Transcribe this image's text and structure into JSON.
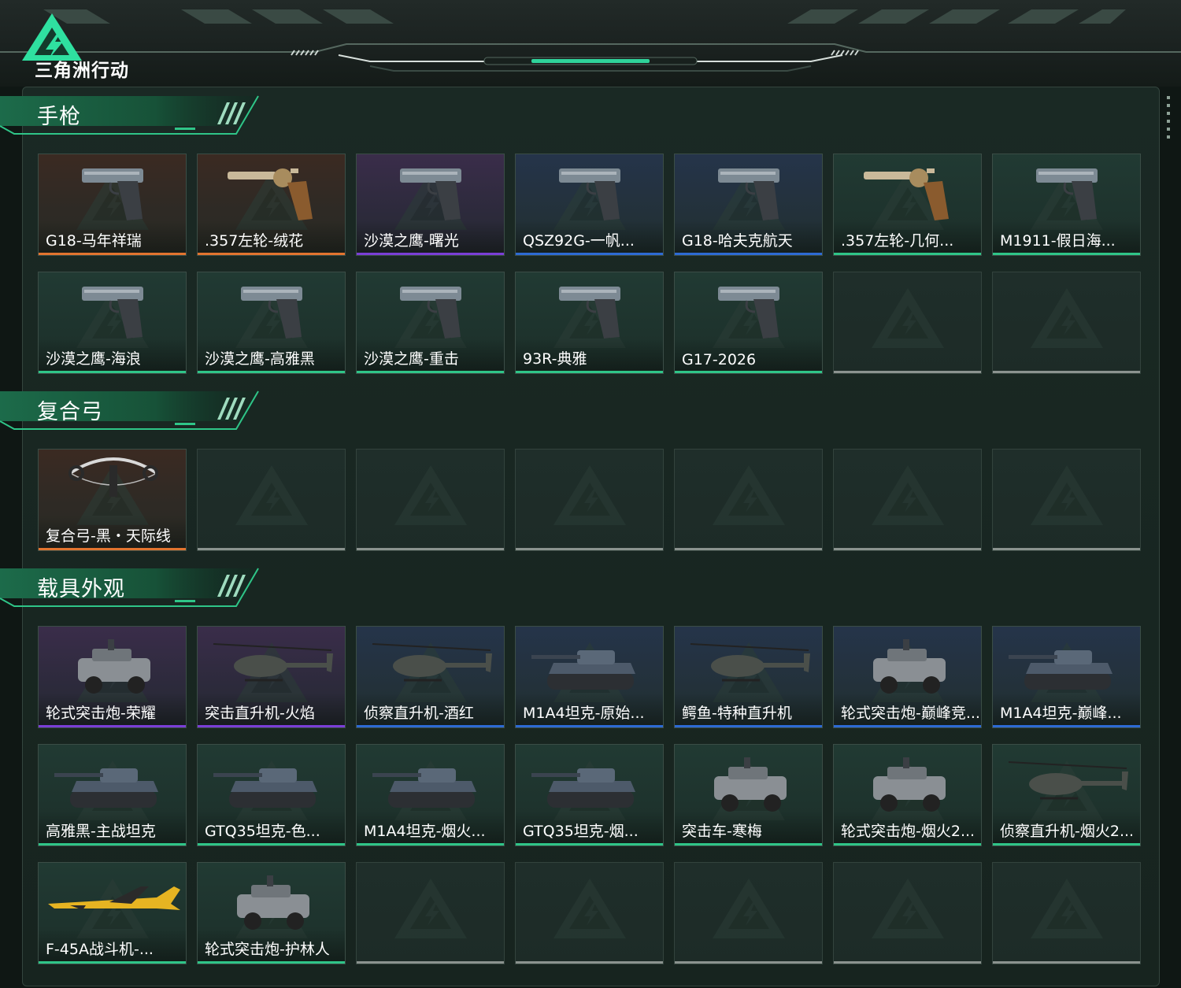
{
  "game": {
    "logo_text": "三角洲行动"
  },
  "colors": {
    "rarity_orange": "#e2742f",
    "rarity_purple": "#7a3ed6",
    "rarity_blue": "#2d6ad3",
    "rarity_green": "#2fc588",
    "accent": "#3fe0a0"
  },
  "sections": [
    {
      "title": "手枪",
      "items": [
        {
          "name": "G18-马年祥瑞",
          "rarity": "orange",
          "icon": "pistol-icon"
        },
        {
          "name": ".357左轮-绒花",
          "rarity": "orange",
          "icon": "revolver-icon"
        },
        {
          "name": "沙漠之鹰-曙光",
          "rarity": "purple",
          "icon": "pistol-icon"
        },
        {
          "name": "QSZ92G-一帆...",
          "rarity": "blue",
          "icon": "pistol-icon"
        },
        {
          "name": "G18-哈夫克航天",
          "rarity": "blue",
          "icon": "pistol-icon"
        },
        {
          "name": ".357左轮-几何...",
          "rarity": "green",
          "icon": "revolver-icon"
        },
        {
          "name": "M1911-假日海...",
          "rarity": "green",
          "icon": "pistol-icon"
        },
        {
          "name": "沙漠之鹰-海浪",
          "rarity": "green",
          "icon": "pistol-icon"
        },
        {
          "name": "沙漠之鹰-高雅黑",
          "rarity": "green",
          "icon": "pistol-icon"
        },
        {
          "name": "沙漠之鹰-重击",
          "rarity": "green",
          "icon": "pistol-icon"
        },
        {
          "name": "93R-典雅",
          "rarity": "green",
          "icon": "pistol-icon"
        },
        {
          "name": "G17-2026",
          "rarity": "green",
          "icon": "pistol-icon"
        },
        {
          "name": "",
          "rarity": "empty"
        },
        {
          "name": "",
          "rarity": "empty"
        }
      ]
    },
    {
      "title": "复合弓",
      "items": [
        {
          "name": "复合弓-黑・天际线",
          "rarity": "orange",
          "icon": "bow-icon"
        },
        {
          "name": "",
          "rarity": "empty"
        },
        {
          "name": "",
          "rarity": "empty"
        },
        {
          "name": "",
          "rarity": "empty"
        },
        {
          "name": "",
          "rarity": "empty"
        },
        {
          "name": "",
          "rarity": "empty"
        },
        {
          "name": "",
          "rarity": "empty"
        }
      ]
    },
    {
      "title": "载具外观",
      "items": [
        {
          "name": "轮式突击炮-荣耀",
          "rarity": "purple",
          "icon": "armored-car-icon"
        },
        {
          "name": "突击直升机-火焰",
          "rarity": "purple",
          "icon": "helicopter-icon"
        },
        {
          "name": "侦察直升机-酒红",
          "rarity": "blue",
          "icon": "helicopter-icon"
        },
        {
          "name": "M1A4坦克-原始...",
          "rarity": "blue",
          "icon": "tank-icon"
        },
        {
          "name": "鳄鱼-特种直升机",
          "rarity": "blue",
          "icon": "helicopter-icon"
        },
        {
          "name": "轮式突击炮-巅峰竞...",
          "rarity": "blue",
          "icon": "armored-car-icon"
        },
        {
          "name": "M1A4坦克-巅峰...",
          "rarity": "blue",
          "icon": "tank-icon"
        },
        {
          "name": "高雅黑-主战坦克",
          "rarity": "green",
          "icon": "tank-icon"
        },
        {
          "name": "GTQ35坦克-色...",
          "rarity": "green",
          "icon": "tank-icon"
        },
        {
          "name": "M1A4坦克-烟火...",
          "rarity": "green",
          "icon": "tank-icon"
        },
        {
          "name": "GTQ35坦克-烟...",
          "rarity": "green",
          "icon": "tank-icon"
        },
        {
          "name": "突击车-寒梅",
          "rarity": "green",
          "icon": "armored-car-icon"
        },
        {
          "name": "轮式突击炮-烟火2...",
          "rarity": "green",
          "icon": "armored-car-icon"
        },
        {
          "name": "侦察直升机-烟火2...",
          "rarity": "green",
          "icon": "helicopter-icon"
        },
        {
          "name": "F-45A战斗机-...",
          "rarity": "green",
          "icon": "jet-icon"
        },
        {
          "name": "轮式突击炮-护林人",
          "rarity": "green",
          "icon": "armored-car-icon"
        },
        {
          "name": "",
          "rarity": "empty"
        },
        {
          "name": "",
          "rarity": "empty"
        },
        {
          "name": "",
          "rarity": "empty"
        },
        {
          "name": "",
          "rarity": "empty"
        },
        {
          "name": "",
          "rarity": "empty"
        }
      ]
    }
  ]
}
